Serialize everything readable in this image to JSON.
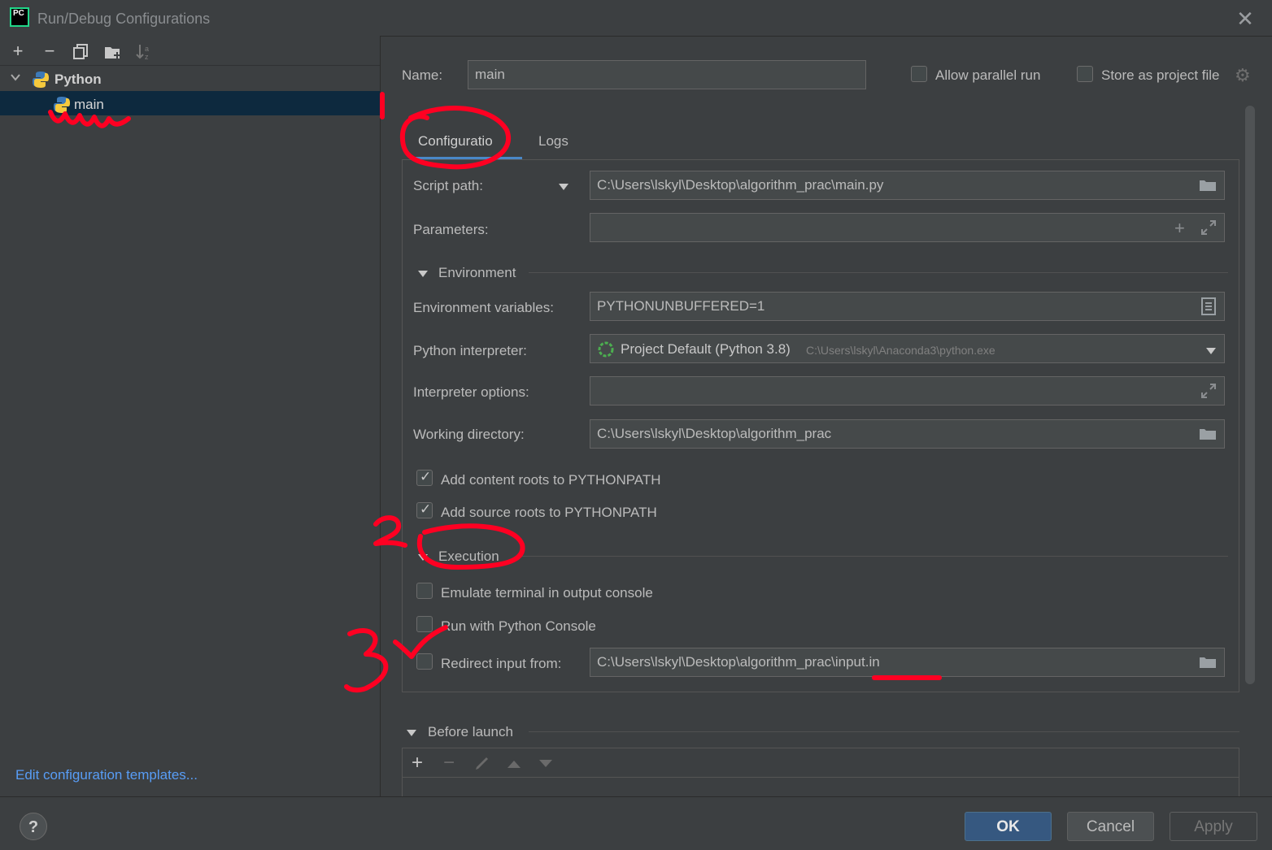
{
  "window": {
    "title": "Run/Debug Configurations",
    "app_icon_text": "PC"
  },
  "left_panel": {
    "tree": [
      {
        "label": "Python",
        "expanded": true
      },
      {
        "label": "main",
        "selected": true
      }
    ],
    "edit_templates_link": "Edit configuration templates..."
  },
  "header": {
    "name_label": "Name:",
    "name_value": "main",
    "allow_parallel_label": "Allow parallel run",
    "allow_parallel_checked": false,
    "store_project_label": "Store as project file",
    "store_project_checked": false
  },
  "tabs": [
    {
      "label": "Configuratio",
      "active": true
    },
    {
      "label": "Logs",
      "active": false
    }
  ],
  "config": {
    "script_path_label": "Script path:",
    "script_path_value": "C:\\Users\\lskyl\\Desktop\\algorithm_prac\\main.py",
    "parameters_label": "Parameters:",
    "parameters_value": "",
    "environment_section": "Environment",
    "env_vars_label": "Environment variables:",
    "env_vars_value": "PYTHONUNBUFFERED=1",
    "interpreter_label": "Python interpreter:",
    "interpreter_value": "Project Default (Python 3.8)",
    "interpreter_path": "C:\\Users\\lskyl\\Anaconda3\\python.exe",
    "interp_options_label": "Interpreter options:",
    "interp_options_value": "",
    "working_dir_label": "Working directory:",
    "working_dir_value": "C:\\Users\\lskyl\\Desktop\\algorithm_prac",
    "content_roots_label": "Add content roots to PYTHONPATH",
    "content_roots_checked": true,
    "source_roots_label": "Add source roots to PYTHONPATH",
    "source_roots_checked": true,
    "execution_section": "Execution",
    "emulate_terminal_label": "Emulate terminal in output console",
    "emulate_terminal_checked": false,
    "python_console_label": "Run with Python Console",
    "python_console_checked": false,
    "redirect_input_label": "Redirect input from:",
    "redirect_input_checked": false,
    "redirect_input_value": "C:\\Users\\lskyl\\Desktop\\algorithm_prac\\input.in"
  },
  "before_launch": {
    "section": "Before launch"
  },
  "buttons": {
    "ok": "OK",
    "cancel": "Cancel",
    "apply": "Apply",
    "help": "?"
  },
  "annotations": [
    "1",
    "2",
    "3"
  ],
  "colors": {
    "annotation": "#ff0022",
    "selection": "#0d293e",
    "link": "#589df6",
    "ok_button": "#365880"
  }
}
